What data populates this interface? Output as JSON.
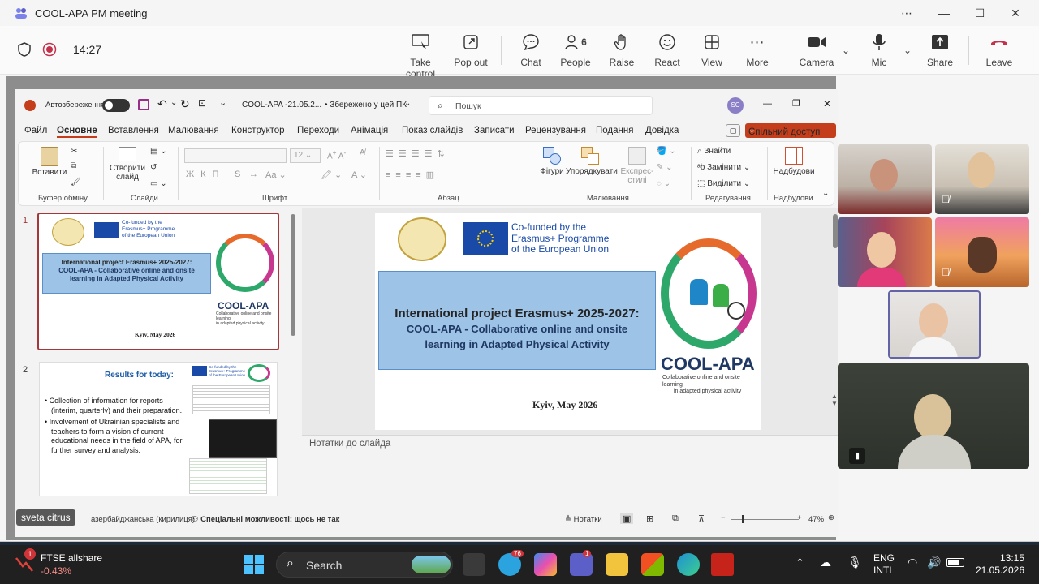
{
  "window": {
    "title": "COOL-APA PM meeting"
  },
  "toolbar": {
    "timer": "14:27",
    "buttons": {
      "take_control": "Take control",
      "pop_out": "Pop out",
      "chat": "Chat",
      "people": "People",
      "people_count": "6",
      "raise": "Raise",
      "react": "React",
      "view": "View",
      "more": "More",
      "camera": "Camera",
      "mic": "Mic",
      "share": "Share",
      "leave": "Leave"
    }
  },
  "ppt": {
    "autosave_label": "Автозбереження",
    "file_name": "COOL-APA -21.05.2...",
    "saved_status": "• Збережено у цей ПК",
    "search_placeholder": "Пошук",
    "user_initials": "SC",
    "menu": [
      "Файл",
      "Основне",
      "Вставлення",
      "Малювання",
      "Конструктор",
      "Переходи",
      "Анімація",
      "Показ слайдів",
      "Записати",
      "Рецензування",
      "Подання",
      "Довідка"
    ],
    "share_button": "Спільний доступ",
    "ribbon": {
      "paste": "Вставити",
      "clipboard_group": "Буфер обміну",
      "new_slide": "Створити слайд",
      "slides_group": "Слайди",
      "font_size": "12",
      "font_group": "Шрифт",
      "paragraph_group": "Абзац",
      "shapes": "Фігури",
      "arrange": "Упорядкувати",
      "quick_styles": "Експрес-стилі",
      "drawing_group": "Малювання",
      "find": "Знайти",
      "replace": "Замінити",
      "select": "Виділити",
      "editing_group": "Редагування",
      "addins": "Надбудови",
      "addins_group": "Надбудови"
    },
    "slides": {
      "slide1_num": "1",
      "slide2_num": "2",
      "cofunded_line1": "Co-funded by the",
      "cofunded_line2": "Erasmus+ Programme",
      "cofunded_line3": "of the European Union",
      "title_line1": "International project Erasmus+ 2025-2027:",
      "title_line2": "COOL-APA - Collaborative online and onsite",
      "title_line3": "learning in Adapted Physical Activity",
      "logo_text": "COOL-APA",
      "logo_sub1": "Collaborative online and onsite learning",
      "logo_sub2": "in adapted physical activity",
      "place_date": "Kyiv, May 2026",
      "s2_heading": "Results for today:",
      "s2_bullet1": "Collection of information for reports (interim, quarterly) and their preparation.",
      "s2_bullet2": "Involvement of Ukrainian specialists and teachers to form a vision of current educational needs in the field of APA, for further survey and analysis."
    },
    "notes_placeholder": "Нотатки до слайда",
    "status": {
      "presenter_label": "sveta citrus",
      "language": "азербайджанська (кирилиця)",
      "accessibility": "Спеціальні можливості: щось не так",
      "notes_btn": "Нотатки",
      "zoom": "47%"
    }
  },
  "taskbar": {
    "stock_name": "FTSE allshare",
    "stock_change": "-0.43%",
    "stock_badge": "1",
    "search_label": "Search",
    "telegram_badge": "76",
    "teams_badge": "1",
    "lang_top": "ENG",
    "lang_bottom": "INTL",
    "time": "13:15",
    "date": "21.05.2026"
  },
  "colors": {
    "leave_red": "#c4314b",
    "ppt_accent": "#c43e1c",
    "slide_title_bg": "#9dc3e6",
    "eu_blue": "#1a4aa8"
  }
}
